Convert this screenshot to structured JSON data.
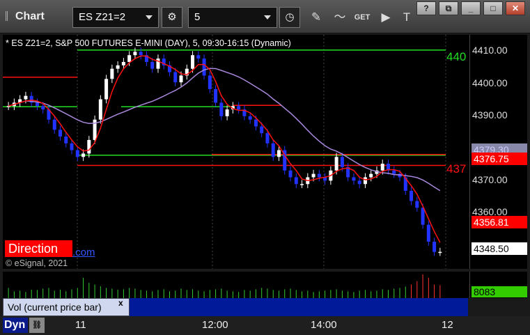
{
  "titlebar": {
    "app_title": "Chart",
    "symbol": "ES Z21=2",
    "interval": "5",
    "get_label": "GET"
  },
  "chart_header": "* ES Z21=2, S&P 500 FUTURES E-MINI (DAY), 5, 09:30-16:15 (Dynamic)",
  "price_axis": [
    "4410.00",
    "4400.00",
    "4390.00",
    "4370.00",
    "4360.00"
  ],
  "price_tags": [
    {
      "text": "4379.30",
      "bg": "#8888aa",
      "fg": "#ccccff"
    },
    {
      "text": "4376.75",
      "bg": "#ff0000",
      "fg": "#ffffff"
    },
    {
      "text": "4356.81",
      "bg": "#ff0000",
      "fg": "#ffffff"
    },
    {
      "text": "4348.50",
      "bg": "#ffffff",
      "fg": "#000000"
    }
  ],
  "level_labels": {
    "green": "440",
    "red": "437"
  },
  "direction": {
    "label": "Direction",
    "link_tail": ".com"
  },
  "copyright": "© eSignal, 2021",
  "volume": {
    "study_label": "Vol (current price bar)",
    "value": "8083",
    "close": "x"
  },
  "time_axis": {
    "dyn": "Dyn",
    "labels": [
      "11",
      "12:00",
      "14:00",
      "12"
    ]
  },
  "colors": {
    "up": "#ffffff",
    "down": "#2233ff",
    "green_line": "#22dd22",
    "red_line": "#ff1111",
    "avg_line": "#aa88dd"
  },
  "chart_data": {
    "type": "candlestick",
    "title": "* ES Z21=2, S&P 500 FUTURES E-MINI (DAY), 5, 09:30-16:15 (Dynamic)",
    "ylim": [
      4343,
      4412
    ],
    "levels": [
      {
        "name": "green_top",
        "value": 4407.5
      },
      {
        "name": "red_upper",
        "value": 4376.7
      },
      {
        "name": "red_lower",
        "value": 4373.5
      },
      {
        "name": "green_low",
        "value": 4376.5
      },
      {
        "name": "green_mid",
        "value": 4390.8
      },
      {
        "name": "red_mid",
        "value": 4391.2
      }
    ],
    "closes": [
      4391,
      4392,
      4393,
      4394,
      4392,
      4391,
      4390,
      4387,
      4384,
      4382,
      4380,
      4378,
      4376,
      4377,
      4381,
      4387,
      4393,
      4399,
      4402,
      4403,
      4404,
      4406,
      4407,
      4406,
      4404,
      4402,
      4405,
      4403,
      4401,
      4398,
      4400,
      4402,
      4406,
      4405,
      4400,
      4396,
      4392,
      4388,
      4390,
      4391,
      4390,
      4388,
      4387,
      4385,
      4383,
      4380,
      4376,
      4378,
      4372,
      4370,
      4368,
      4368,
      4370,
      4371,
      4370,
      4369,
      4372,
      4376,
      4373,
      4370,
      4369,
      4368,
      4370,
      4371,
      4372,
      4374,
      4372,
      4371,
      4370,
      4366,
      4363,
      4361,
      4356,
      4351,
      4348,
      4348
    ],
    "volume": [
      30,
      20,
      22,
      18,
      25,
      24,
      28,
      30,
      22,
      25,
      20,
      26,
      30,
      60,
      45,
      40,
      35,
      30,
      28,
      25,
      26,
      30,
      28,
      24,
      22,
      20,
      24,
      26,
      20,
      22,
      28,
      24,
      26,
      22,
      20,
      24,
      26,
      28,
      22,
      20,
      18,
      24,
      22,
      26,
      30,
      28,
      24,
      22,
      26,
      28,
      24,
      20,
      22,
      18,
      20,
      22,
      24,
      26,
      22,
      20,
      18,
      22,
      24,
      20,
      22,
      26,
      24,
      28,
      30,
      34,
      40,
      50,
      70,
      60,
      40,
      38
    ]
  }
}
